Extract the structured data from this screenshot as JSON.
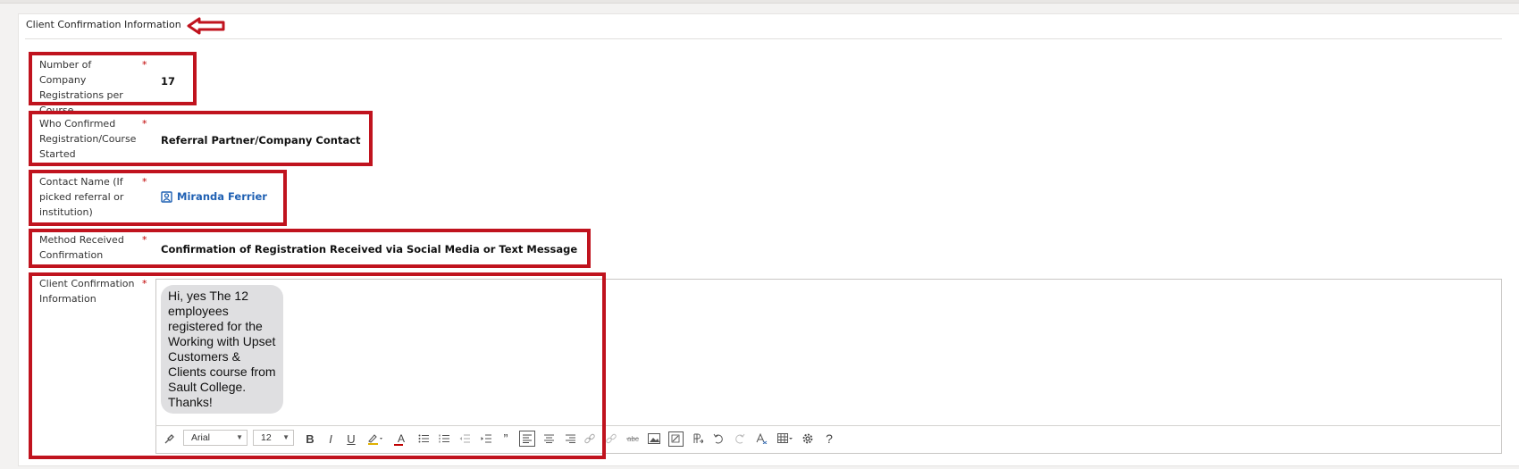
{
  "section": {
    "title": "Client Confirmation Information"
  },
  "fields": {
    "registrations": {
      "label": "Number of Company Registrations per Course",
      "required": "*",
      "value": "17"
    },
    "who_confirmed": {
      "label": "Who Confirmed Registration/Course Started",
      "required": "*",
      "value": "Referral Partner/Company Contact"
    },
    "contact_name": {
      "label": "Contact Name (If picked referral or institution)",
      "required": "*",
      "value": "Miranda Ferrier"
    },
    "method": {
      "label": "Method Received Confirmation",
      "required": "*",
      "value": "Confirmation of Registration Received via Social Media or Text Message"
    },
    "confirmation_info": {
      "label": "Client Confirmation Information",
      "required": "*",
      "message": "Hi, yes The 12 employees registered for the Working with Upset Customers & Clients course from Sault College. Thanks!"
    }
  },
  "toolbar": {
    "font_family": "Arial",
    "font_size": "12",
    "bold": "B",
    "italic": "I",
    "underline": "U",
    "font_color": "A",
    "quote": "”",
    "help": "?"
  },
  "colors": {
    "annotation_red": "#c0131e",
    "lookup_blue": "#1f60b3",
    "required_red": "#c00000"
  }
}
